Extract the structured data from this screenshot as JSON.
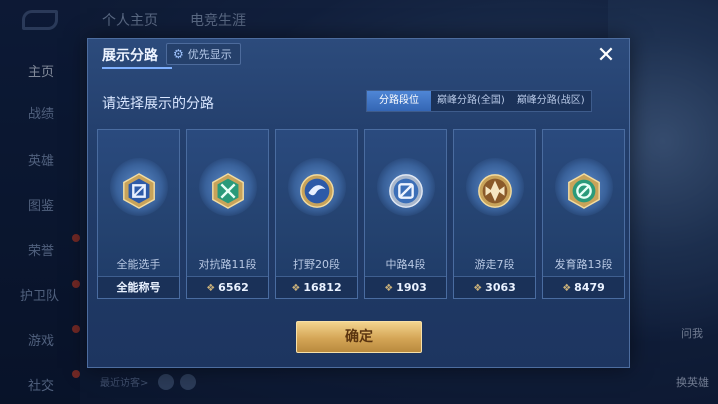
{
  "sidebar": {
    "items": [
      {
        "label": "主页",
        "badge": false
      },
      {
        "label": "战绩",
        "badge": false
      },
      {
        "label": "英雄",
        "badge": false
      },
      {
        "label": "图鉴",
        "badge": false
      },
      {
        "label": "荣誉",
        "badge": true
      },
      {
        "label": "护卫队",
        "badge": true
      },
      {
        "label": "游戏",
        "badge": true
      },
      {
        "label": "社交",
        "badge": true
      }
    ]
  },
  "topnav": {
    "tab1": "个人主页",
    "tab2": "电竞生涯"
  },
  "background": {
    "visitors": "最近访客>",
    "right_label1": "问我",
    "right_label2": "换英雄"
  },
  "modal": {
    "title": "展示分路",
    "priority_label": "优先显示",
    "prompt": "请选择展示的分路",
    "tabs": [
      "分路段位",
      "巅峰分路(全国)",
      "巅峰分路(战区)"
    ],
    "cards": [
      {
        "name": "全能选手",
        "footer": "全能称号",
        "emblem": "allround-emblem-icon"
      },
      {
        "name": "对抗路11段",
        "score": "6562",
        "emblem": "clash-lane-emblem-icon"
      },
      {
        "name": "打野20段",
        "score": "16812",
        "emblem": "jungle-emblem-icon"
      },
      {
        "name": "中路4段",
        "score": "1903",
        "emblem": "mid-lane-emblem-icon"
      },
      {
        "name": "游走7段",
        "score": "3063",
        "emblem": "roam-emblem-icon"
      },
      {
        "name": "发育路13段",
        "score": "8479",
        "emblem": "farm-lane-emblem-icon"
      }
    ],
    "confirm": "确定"
  },
  "colors": {
    "accent": "#3466b4",
    "confirm": "#d4a556",
    "score_icon": "#c9b07a"
  }
}
